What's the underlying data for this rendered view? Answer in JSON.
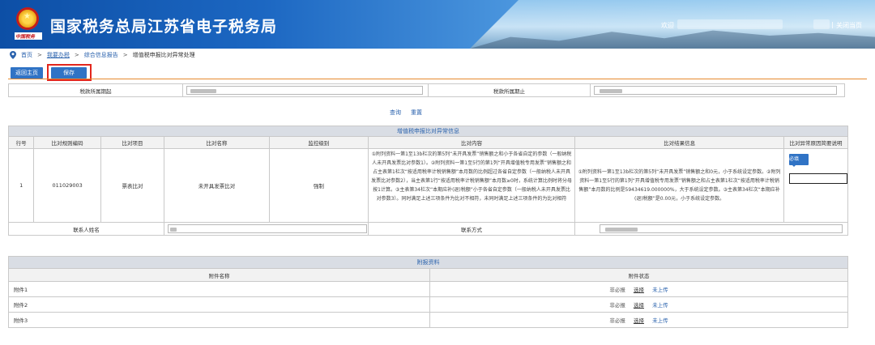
{
  "header": {
    "site_title": "国家税务总局江苏省电子税务局",
    "emblem_caption": "中国税务",
    "welcome": "欢迎",
    "separator": "|",
    "logout": "关闭当页"
  },
  "breadcrumb": [
    "首页",
    "我要办税",
    "综合信息报告",
    "增值税申报比对异常处理"
  ],
  "breadcrumb_arrow": ">",
  "toolbar": {
    "home_label": "返回主页",
    "save_label": "保存"
  },
  "period": {
    "start_label": "税款所属期起",
    "end_label": "税款所属期止"
  },
  "actions": {
    "query": "查询",
    "reset": "重置"
  },
  "compare_table": {
    "caption": "增值税申报比对异常信息",
    "columns": [
      "行号",
      "比对规则编码",
      "比对项目",
      "比对名称",
      "监控级别",
      "比对内容",
      "比对结果信息",
      "比对异常原因简要说明"
    ],
    "rows": [
      {
        "line_no": "1",
        "rule_code": "011029003",
        "item": "票表比对",
        "name": "未开具发票比对",
        "level": "强制",
        "content": "①附列资料一第1至13b栏次的第5列“未开具发票”销售额之和小于各省自定的参数（一般纳税人未开具发票比对参数1）。②附列资料一第1至5行的第1列“开具增值税专用发票”销售额之和占主表第1栏次“按适用税率计税销售额”本月数的比例超过各省自定参数（一般纳税人未开具发票比对参数2），当主表第1行“按适用税率计税销售额”本月数≥0时，系统计算比例时将分母按1计算。③主表第34栏次“本期应补(退)税额”小于各省自定参数（一般纳税人未开具发票比对参数3）。同时满足上述三项条件为比对不相符，未同时满足上述三项条件的为比对相符",
        "result": "①附列资料一第1至13b栏次的第5列“未开具发票”销售额之和0元，小于系统设定参数。②附列资料一第1至5行的第1列“开具增值税专用发票”销售额之和占主表第1栏次“按适用税率计税销售额”本月数的比例是59434619.000000%，大于系统设定参数。③主表第34栏次“本期应补(退)税额”是0.00元，小于系统设定参数。",
        "required_label": "必填"
      }
    ],
    "contact_name_label": "联系人姓名",
    "contact_method_label": "联系方式"
  },
  "attachments": {
    "caption": "附报资料",
    "columns": [
      "附件名称",
      "附件状态"
    ],
    "items": [
      {
        "name": "附件1",
        "required": "非必报",
        "select": "选择",
        "status": "未上传"
      },
      {
        "name": "附件2",
        "required": "非必报",
        "select": "选择",
        "status": "未上传"
      },
      {
        "name": "附件3",
        "required": "非必报",
        "select": "选择",
        "status": "未上传"
      }
    ]
  },
  "colors": {
    "brand_blue": "#3073c5",
    "link_blue": "#2a62ad",
    "highlight_red": "#e3261c",
    "divider_orange": "#e68a2e"
  }
}
